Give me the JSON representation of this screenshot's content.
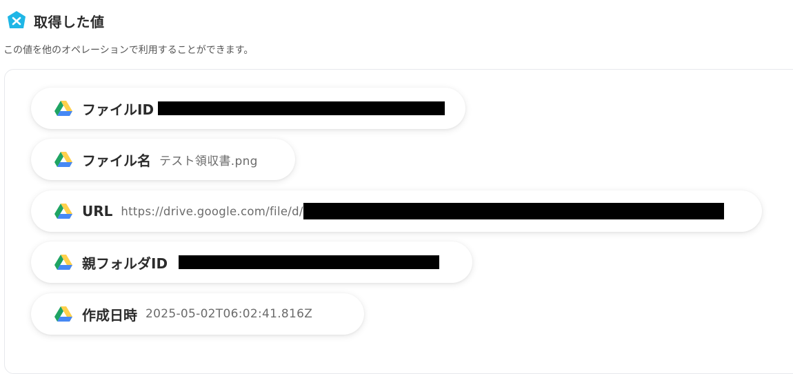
{
  "header": {
    "title": "取得した値",
    "logo_icon": "yoom-logo-icon",
    "logo_color": "#1fb6e6"
  },
  "description": "この値を他のオペレーションで利用することができます。",
  "fields": [
    {
      "label": "ファイルID",
      "value": "",
      "redacted": true,
      "icon": "google-drive-icon"
    },
    {
      "label": "ファイル名",
      "value": "テスト領収書.png",
      "redacted": false,
      "icon": "google-drive-icon"
    },
    {
      "label": "URL",
      "value": "https://drive.google.com/file/d/",
      "redacted": true,
      "icon": "google-drive-icon"
    },
    {
      "label": "親フォルダID",
      "value": "",
      "redacted": true,
      "icon": "google-drive-icon"
    },
    {
      "label": "作成日時",
      "value": "2025-05-02T06:02:41.816Z",
      "redacted": false,
      "icon": "google-drive-icon"
    }
  ],
  "colors": {
    "drive_green": "#1fa463",
    "drive_yellow": "#ffd04b",
    "drive_blue": "#4688f4",
    "redaction": "#000000"
  }
}
